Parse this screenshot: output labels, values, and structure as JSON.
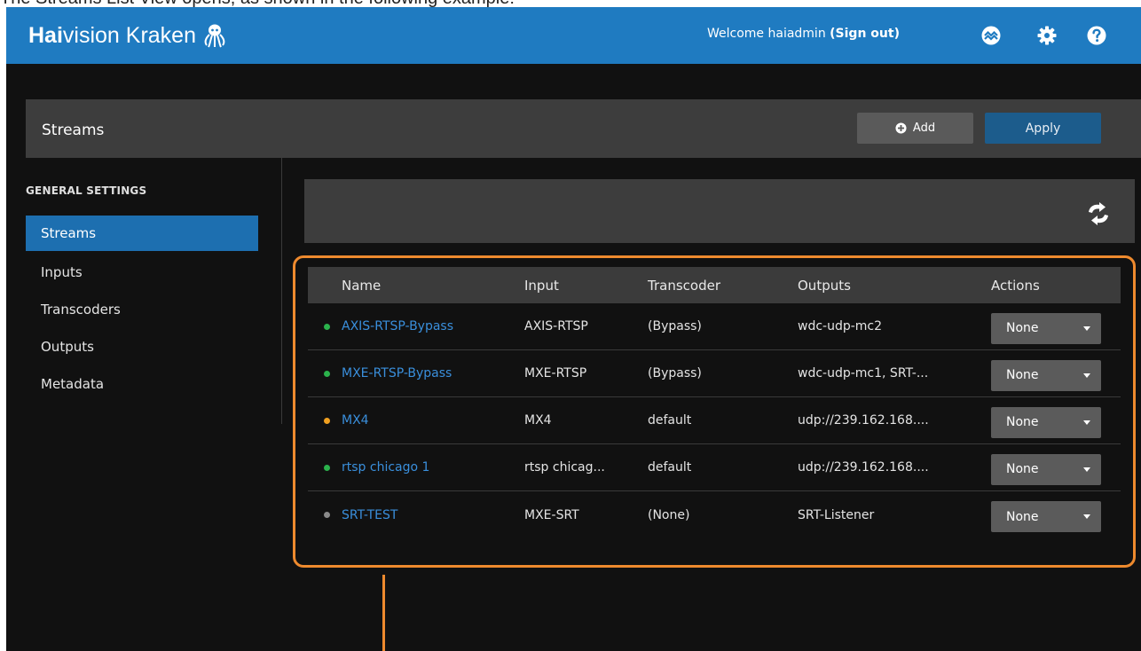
{
  "caption": "The Streams List View opens, as shown in the following example:",
  "header": {
    "brand_bold": "Hai",
    "brand_rest": "vision Kraken",
    "welcome_text": "Welcome haiadmin",
    "signout_label": "(Sign out)",
    "icons": [
      "status-icon",
      "gear-icon",
      "help-icon"
    ]
  },
  "page": {
    "title": "Streams",
    "add_label": "Add",
    "apply_label": "Apply"
  },
  "sidebar": {
    "heading": "GENERAL SETTINGS",
    "items": [
      {
        "label": "Streams",
        "active": true
      },
      {
        "label": "Inputs",
        "active": false
      },
      {
        "label": "Transcoders",
        "active": false
      },
      {
        "label": "Outputs",
        "active": false
      },
      {
        "label": "Metadata",
        "active": false
      }
    ]
  },
  "table": {
    "columns": [
      "Name",
      "Input",
      "Transcoder",
      "Outputs",
      "Actions"
    ],
    "rows": [
      {
        "status_color": "#2bb24c",
        "name": "AXIS-RTSP-Bypass",
        "input": "AXIS-RTSP",
        "transcoder": "(Bypass)",
        "outputs": "wdc-udp-mc2",
        "action": "None"
      },
      {
        "status_color": "#2bb24c",
        "name": "MXE-RTSP-Bypass",
        "input": "MXE-RTSP",
        "transcoder": "(Bypass)",
        "outputs": "wdc-udp-mc1, SRT-...",
        "action": "None"
      },
      {
        "status_color": "#f0a020",
        "name": "MX4",
        "input": "MX4",
        "transcoder": "default",
        "outputs": "udp://239.162.168....",
        "action": "None"
      },
      {
        "status_color": "#2bb24c",
        "name": "rtsp chicago 1",
        "input": "rtsp chicag...",
        "transcoder": "default",
        "outputs": "udp://239.162.168....",
        "action": "None"
      },
      {
        "status_color": "#8a8a8a",
        "name": "SRT-TEST",
        "input": "MXE-SRT",
        "transcoder": "(None)",
        "outputs": "SRT-Listener",
        "action": "None"
      }
    ]
  },
  "colors": {
    "header_blue": "#1f7bc1",
    "highlight_orange": "#ee8a2e",
    "link_blue": "#3a8fdc"
  }
}
